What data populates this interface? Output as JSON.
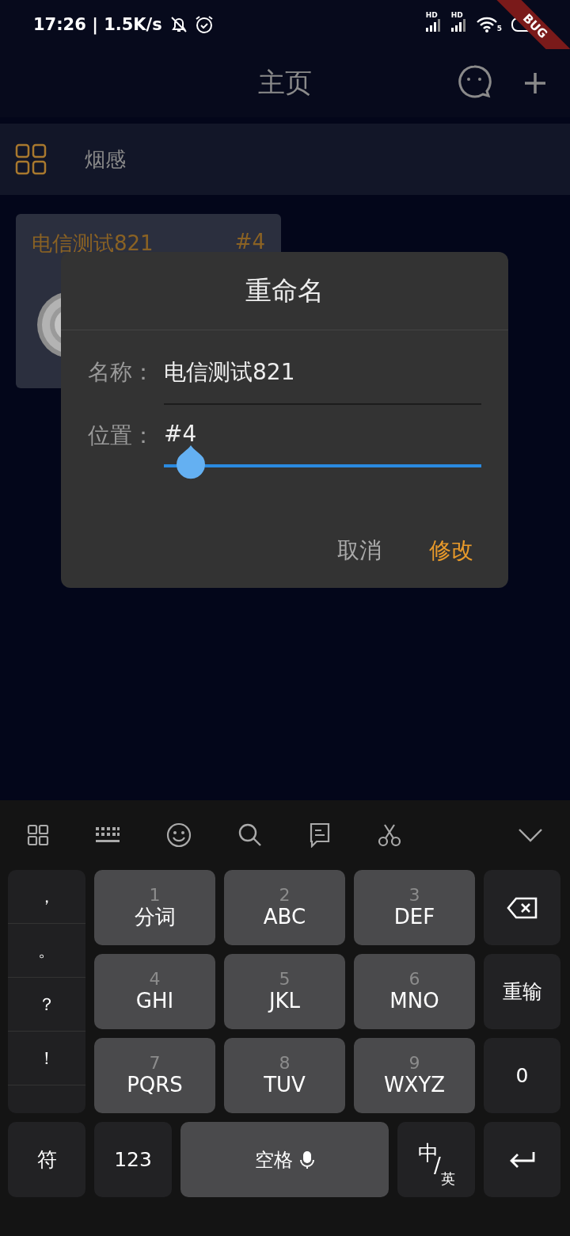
{
  "status_bar": {
    "time": "17:26",
    "separator": "|",
    "speed": "1.5K/s",
    "signals": [
      {
        "badge": "HD"
      },
      {
        "badge": "HD"
      }
    ],
    "wifi_badge": "5"
  },
  "debug_banner": {
    "text": "BUG"
  },
  "app_bar": {
    "title": "主页"
  },
  "category_bar": {
    "label": "烟感"
  },
  "devices": [
    {
      "name": "电信测试821",
      "position": "#4"
    }
  ],
  "dialog": {
    "title": "重命名",
    "name_label": "名称：",
    "name_value": "电信测试821",
    "position_label": "位置：",
    "position_value": "#4",
    "slider": {
      "level": 0.085
    },
    "buttons": [
      {
        "label": "取消",
        "kind": "cancel"
      },
      {
        "label": "修改",
        "kind": "confirm"
      }
    ]
  },
  "keyboard": {
    "punctuation": [
      "，",
      "。",
      "？",
      "！"
    ],
    "keys": [
      {
        "digit": "1",
        "letters": "分词"
      },
      {
        "digit": "2",
        "letters": "ABC"
      },
      {
        "digit": "3",
        "letters": "DEF"
      },
      {
        "digit": "4",
        "letters": "GHI"
      },
      {
        "digit": "5",
        "letters": "JKL"
      },
      {
        "digit": "6",
        "letters": "MNO"
      },
      {
        "digit": "7",
        "letters": "PQRS"
      },
      {
        "digit": "8",
        "letters": "TUV"
      },
      {
        "digit": "9",
        "letters": "WXYZ"
      }
    ],
    "side_keys": [
      {
        "kind": "backspace"
      },
      {
        "kind": "text",
        "label": "重输"
      },
      {
        "kind": "text",
        "label": "0"
      }
    ],
    "bottom_keys": [
      {
        "kind": "text",
        "label": "符"
      },
      {
        "kind": "text",
        "label": "123"
      },
      {
        "kind": "space",
        "label": "空格"
      },
      {
        "kind": "lang",
        "main": "中",
        "sep": "/",
        "sub": "英"
      },
      {
        "kind": "enter"
      }
    ]
  }
}
